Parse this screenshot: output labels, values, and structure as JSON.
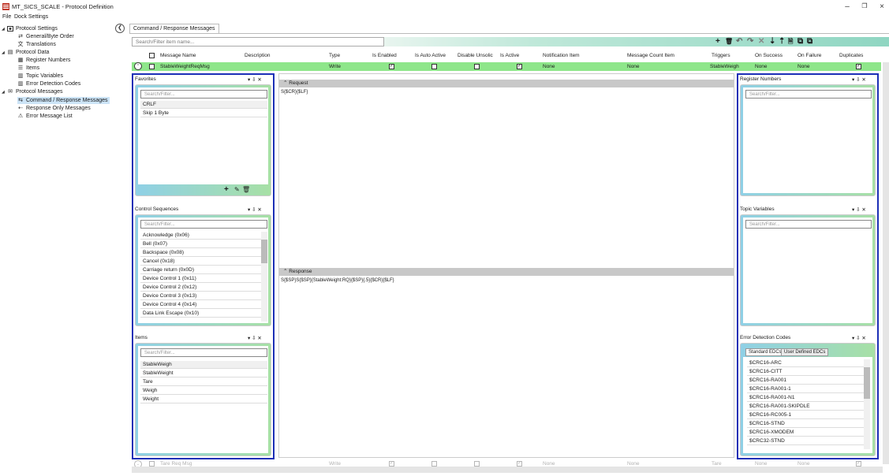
{
  "window": {
    "title": "MT_SICS_SCALE - Protocol Definition",
    "minimize": "–",
    "maximize": "❐",
    "close": "×"
  },
  "menu": [
    "File",
    "Dock Settings"
  ],
  "tree": [
    {
      "label": "Protocol Settings",
      "level": 0,
      "icon": "settings-icon"
    },
    {
      "label": "General/Byte Order",
      "level": 1,
      "icon": "byte-order-icon"
    },
    {
      "label": "Translations",
      "level": 1,
      "icon": "translations-icon"
    },
    {
      "label": "Protocol Data",
      "level": 0,
      "icon": "data-icon"
    },
    {
      "label": "Register Numbers",
      "level": 1,
      "icon": "register-icon"
    },
    {
      "label": "Items",
      "level": 1,
      "icon": "items-icon"
    },
    {
      "label": "Topic Variables",
      "level": 1,
      "icon": "topic-icon"
    },
    {
      "label": "Error Detection Codes",
      "level": 1,
      "icon": "edc-icon"
    },
    {
      "label": "Protocol Messages",
      "level": 0,
      "icon": "messages-icon"
    },
    {
      "label": "Command / Response Messages",
      "level": 1,
      "icon": "command-response-icon",
      "selected": true
    },
    {
      "label": "Response Only Messages",
      "level": 1,
      "icon": "response-only-icon"
    },
    {
      "label": "Error Message List",
      "level": 1,
      "icon": "error-list-icon"
    }
  ],
  "tab": "Command / Response Messages",
  "main_search_placeholder": "Search/Filter item name...",
  "toolbar_icons": [
    "+",
    "🗑",
    "↶",
    "↷",
    "✕",
    "⇣",
    "⇡",
    "🗎",
    "⧉",
    "⧉"
  ],
  "grid": {
    "columns": [
      "Message Name",
      "Description",
      "Type",
      "Is Enabled",
      "Is Auto Active",
      "Disable Unsolic",
      "Is Active",
      "Notification Item",
      "Message Count Item",
      "Triggers",
      "On Success",
      "On Failure",
      "Duplicates"
    ],
    "row": {
      "name": "StableWeightReqMsg",
      "description": "",
      "type": "Write",
      "is_enabled": true,
      "is_auto_active": false,
      "disable_unsolic": false,
      "is_active": true,
      "notification_item": "None",
      "message_count_item": "None",
      "triggers": "StableWeigh",
      "on_success": "None",
      "on_failure": "None",
      "duplicates": true
    }
  },
  "favorites": {
    "title": "Favorites",
    "search_placeholder": "Search/Filter...",
    "items": [
      "CRLF",
      "Skip 1 Byte"
    ],
    "footer_icons": [
      "+",
      "✎",
      "🗑"
    ]
  },
  "control_sequences": {
    "title": "Control Sequences",
    "search_placeholder": "Search/Filter...",
    "items": [
      "Acknowledge (0x06)",
      "Bell (0x07)",
      "Backspace (0x08)",
      "Cancel (0x18)",
      "Carriage return (0x0D)",
      "Device Control 1 (0x11)",
      "Device Control 2 (0x12)",
      "Device Control 3 (0x13)",
      "Device Control 4 (0x14)",
      "Data Link Escape (0x10)"
    ]
  },
  "items_panel": {
    "title": "Items",
    "search_placeholder": "Search/Filter...",
    "items": [
      "StableWeigh",
      "StableWeight",
      "Tare",
      "Weigh",
      "Weight"
    ]
  },
  "request": {
    "label": "Request",
    "text": "S{$CR}{$LF}"
  },
  "response": {
    "label": "Response",
    "text": "S{$SP}S{$SP}{StableWeight:RQ}{$SP}{.5}{$CR}{$LF}"
  },
  "register_numbers": {
    "title": "Register Numbers",
    "search_placeholder": "Search/Filter..."
  },
  "topic_variables": {
    "title": "Topic Variables",
    "search_placeholder": "Search/Filter..."
  },
  "edc": {
    "title": "Error Detection Codes",
    "tabs": [
      "Standard EDCs",
      "User Defined EDCs"
    ],
    "items": [
      "$CRC16-ARC",
      "$CRC16-CITT",
      "$CRC16-RA001",
      "$CRC16-RA001-1",
      "$CRC16-RA001-N1",
      "$CRC16-RA001-SKIPDLE",
      "$CRC16-RC005-1",
      "$CRC16-STND",
      "$CRC16-XMODEM",
      "$CRC32-STND"
    ]
  },
  "panel_controls": "▾ ⇩ ✕",
  "bottom_row": {
    "name": "Tare Req Msg",
    "type": "Write",
    "notification_item": "None",
    "message_count_item": "None",
    "triggers": "Tare",
    "on_success": "None",
    "on_failure": "None"
  },
  "colors": {
    "selected_row": "#8ee68a",
    "panel_border": "#1c2fb6",
    "section_bar": "#c8c8c8"
  }
}
